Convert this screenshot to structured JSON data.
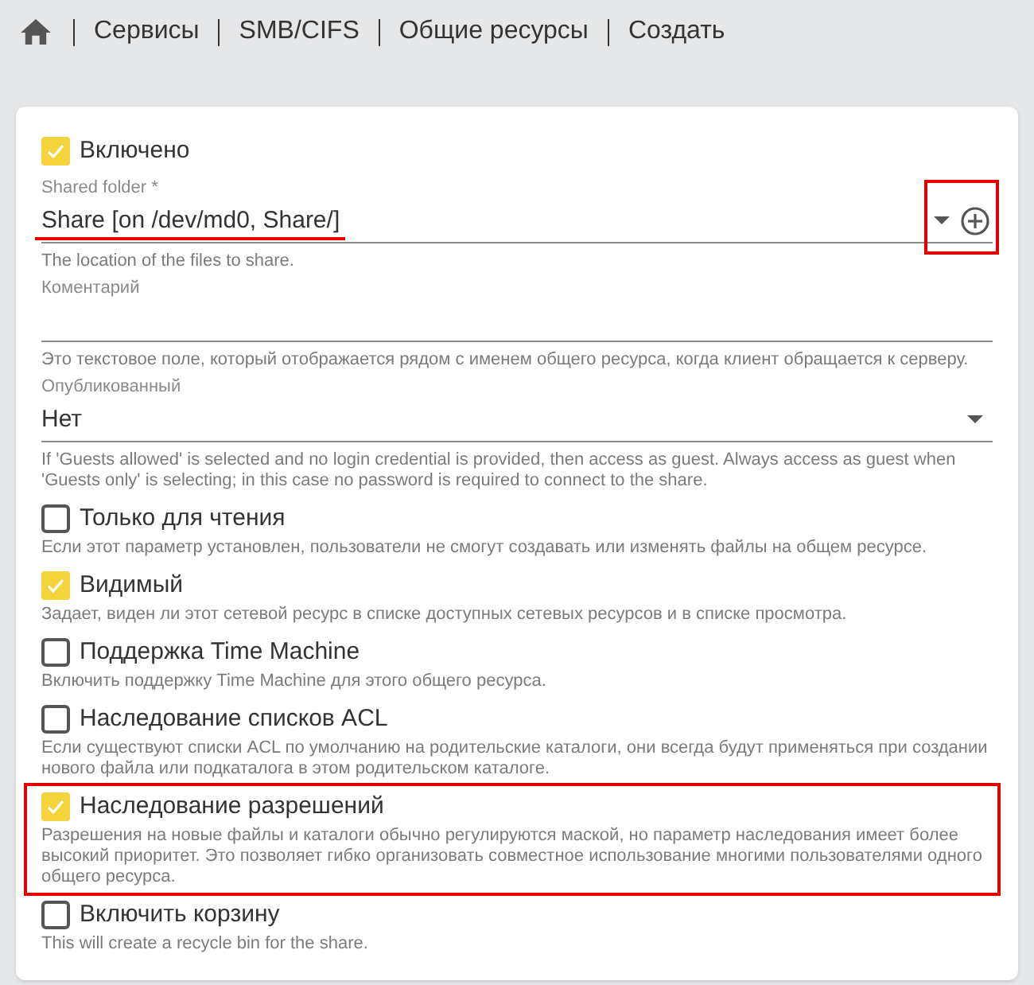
{
  "breadcrumb": {
    "items": [
      "Сервисы",
      "SMB/CIFS",
      "Общие ресурсы",
      "Создать"
    ]
  },
  "form": {
    "fields": [
      {
        "kind": "checkbox",
        "label": "Включено",
        "checked": true
      },
      {
        "kind": "select",
        "label": "Shared folder *",
        "value": "Share [on /dev/md0, Share/]",
        "add_button": true,
        "value_underlined": true,
        "actions_framed": true,
        "hint": "The location of the files to share."
      },
      {
        "kind": "text",
        "label": "Коментарий",
        "hint": "Это текстовое поле, который отображается рядом с именем общего ресурса, когда клиент обращается к серверу."
      },
      {
        "kind": "select",
        "label": "Опубликованный",
        "value": "Нет",
        "hint": "If 'Guests allowed' is selected and no login credential is provided, then access as guest. Always access as guest when 'Guests only' is selecting; in this case no password is required to connect to the share."
      },
      {
        "kind": "checkbox",
        "label": "Только для чтения",
        "checked": false,
        "hint": "Если этот параметр установлен, пользователи не смогут создавать или изменять файлы на общем ресурсе."
      },
      {
        "kind": "checkbox",
        "label": "Видимый",
        "checked": true,
        "hint": "Задает, виден ли этот сетевой ресурс в списке доступных сетевых ресурсов и в списке просмотра."
      },
      {
        "kind": "checkbox",
        "label": "Поддержка Time Machine",
        "checked": false,
        "hint": "Включить поддержку Time Machine для этого общего ресурса."
      },
      {
        "kind": "checkbox",
        "label": "Наследование списков ACL",
        "checked": false,
        "hint": "Если существуют списки ACL по умолчанию на родительские каталоги, они всегда будут применяться при создании нового файла или подкаталога в этом родительском каталоге."
      },
      {
        "kind": "checkbox",
        "label": "Наследование разрешений",
        "checked": true,
        "framed": true,
        "hint": "Разрешения на новые файлы и каталоги обычно регулируются маской, но параметр наследования имеет более высокий приоритет. Это позволяет гибко организовать совместное использование многими пользователями одного общего ресурса."
      },
      {
        "kind": "checkbox",
        "label": "Включить корзину",
        "checked": false,
        "hint": "This will create a recycle bin for the share."
      }
    ]
  }
}
